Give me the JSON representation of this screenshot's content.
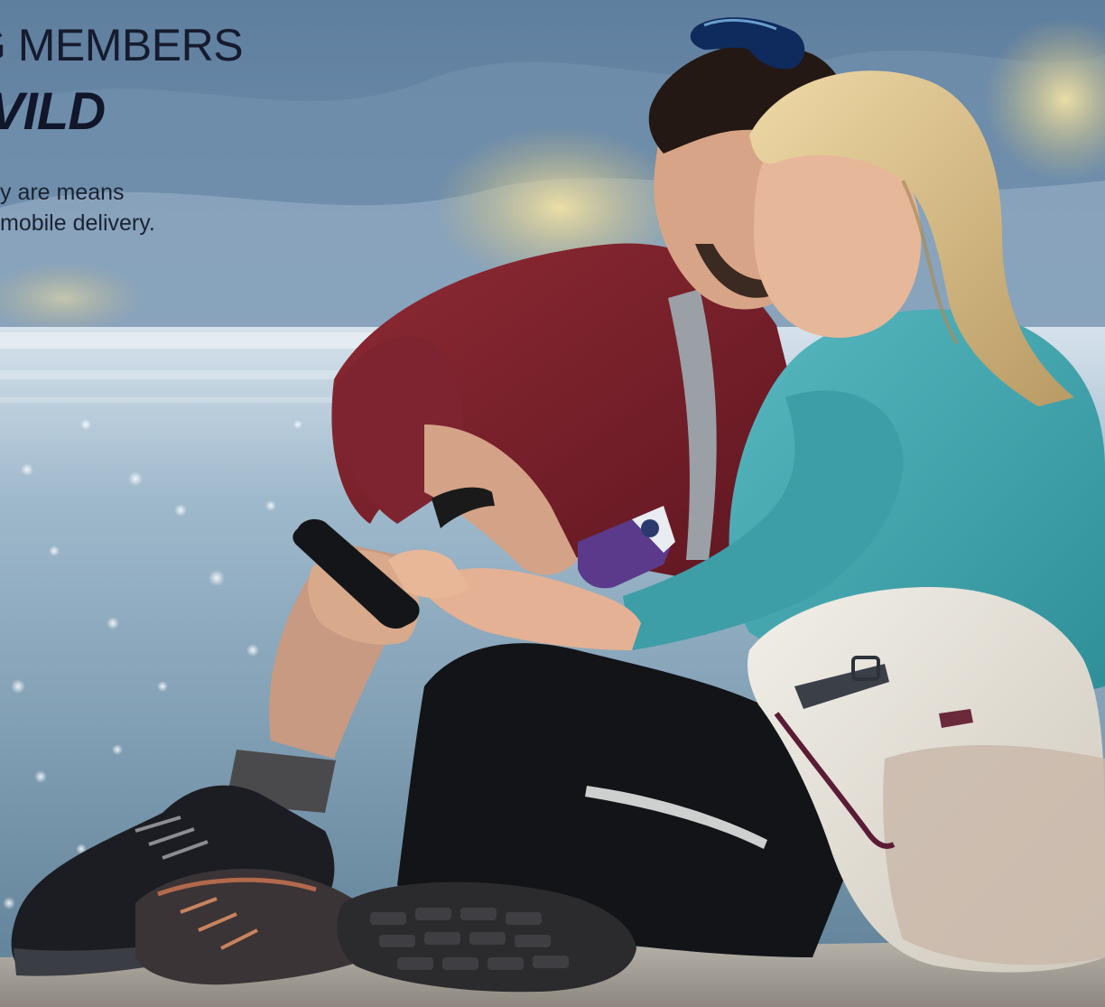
{
  "hero": {
    "headline_line1": "G MEMBERS",
    "headline_line2": "VILD",
    "subcopy_line1": "y are means",
    "subcopy_line2": "mobile delivery."
  },
  "photo": {
    "subject": "couple-hikers-looking-at-phone-by-lake",
    "colors": {
      "sky": "#6f8fae",
      "lake": "#b9cfdf",
      "foliage": "#d9c98a",
      "red_fleece": "#7a1f2a",
      "teal_top": "#3fa3ad",
      "leggings": "#121418",
      "backpack": "#e7e4dc",
      "hair_blonde": "#d9c28f",
      "hair_dark": "#231814",
      "skin": "#e0ad8c",
      "bottle": "#5b3a8c"
    }
  }
}
